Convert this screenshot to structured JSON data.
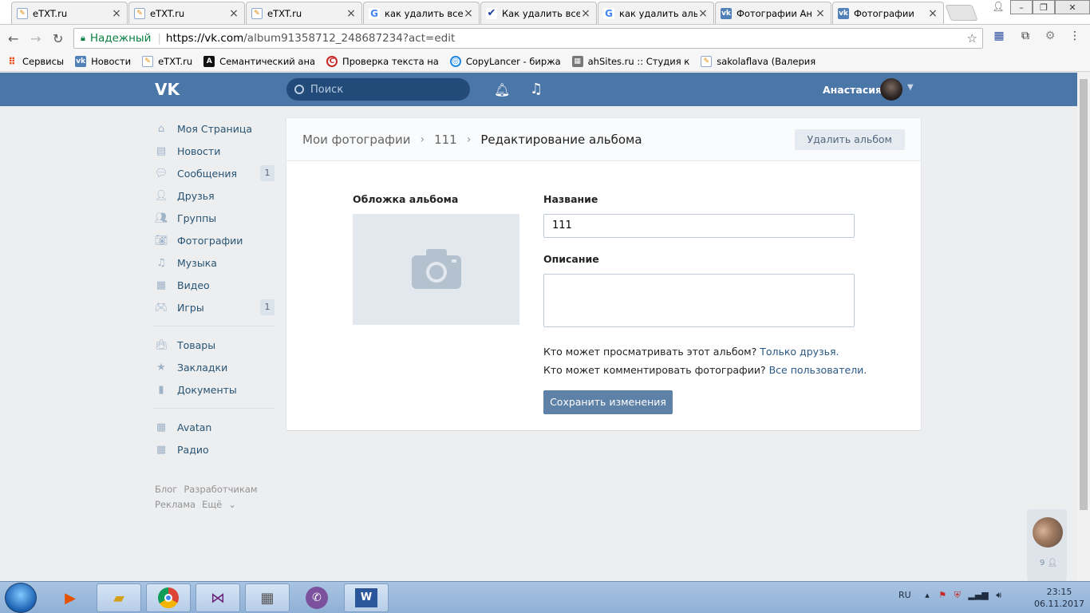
{
  "browser": {
    "tabs": [
      {
        "title": "eTXT.ru",
        "icon": "etxt-favicon"
      },
      {
        "title": "eTXT.ru",
        "icon": "etxt-favicon"
      },
      {
        "title": "eTXT.ru",
        "icon": "etxt-favicon"
      },
      {
        "title": "как удалить все",
        "icon": "google-favicon"
      },
      {
        "title": "Как удалить все",
        "icon": "checkmark-favicon"
      },
      {
        "title": "как удалить аль",
        "icon": "google-favicon"
      },
      {
        "title": "Фотографии Ан",
        "icon": "vk-favicon"
      },
      {
        "title": "Фотографии",
        "icon": "vk-favicon"
      }
    ],
    "secure_label": "Надежный",
    "url_host": "https://vk.com",
    "url_path": "/album91358712_248687234?act=edit",
    "bookmarks": [
      {
        "label": "Сервисы",
        "icon": "apps-icon"
      },
      {
        "label": "Новости",
        "icon": "vk-favicon"
      },
      {
        "label": "eTXT.ru",
        "icon": "etxt-favicon"
      },
      {
        "label": "Семантический ана",
        "icon": "a-favicon"
      },
      {
        "label": "Проверка текста на",
        "icon": "copyright-favicon"
      },
      {
        "label": "CopyLancer - биржа",
        "icon": "copylancer-favicon"
      },
      {
        "label": "ahSites.ru :: Студия к",
        "icon": "ahsites-favicon"
      },
      {
        "label": "sakolaflava (Валерия",
        "icon": "etxt-favicon"
      }
    ]
  },
  "vk": {
    "logo": "VK",
    "search_placeholder": "Поиск",
    "user_name": "Анастасия",
    "menu": [
      {
        "label": "Моя Страница",
        "icon": "home-icon",
        "count": ""
      },
      {
        "label": "Новости",
        "icon": "news-icon",
        "count": ""
      },
      {
        "label": "Сообщения",
        "icon": "messages-icon",
        "count": "1"
      },
      {
        "label": "Друзья",
        "icon": "friends-icon",
        "count": ""
      },
      {
        "label": "Группы",
        "icon": "groups-icon",
        "count": ""
      },
      {
        "label": "Фотографии",
        "icon": "camera-icon",
        "count": ""
      },
      {
        "label": "Музыка",
        "icon": "music-icon",
        "count": ""
      },
      {
        "label": "Видео",
        "icon": "video-icon",
        "count": ""
      },
      {
        "label": "Игры",
        "icon": "games-icon",
        "count": "1"
      }
    ],
    "menu2": [
      {
        "label": "Товары",
        "icon": "bag-icon"
      },
      {
        "label": "Закладки",
        "icon": "star-icon"
      },
      {
        "label": "Документы",
        "icon": "document-icon"
      }
    ],
    "menu3": [
      {
        "label": "Avatan",
        "icon": "apps-icon"
      },
      {
        "label": "Радио",
        "icon": "apps-icon"
      }
    ],
    "footer": {
      "blog": "Блог",
      "dev": "Разработчикам",
      "ads": "Реклама",
      "more": "Ещё"
    }
  },
  "page": {
    "breadcrumb": [
      "Мои фотографии",
      "111",
      "Редактирование альбома"
    ],
    "delete_button": "Удалить альбом",
    "cover_label": "Обложка альбома",
    "name_label": "Название",
    "name_value": "111",
    "description_label": "Описание",
    "description_value": "",
    "view_question": "Кто может просматривать этот альбом?",
    "view_value": "Только друзья.",
    "comment_question": "Кто может комментировать фотографии?",
    "comment_value": "Все пользователи.",
    "save_button": "Сохранить изменения"
  },
  "side_widget": {
    "count": "9"
  },
  "taskbar": {
    "lang": "RU",
    "time": "23:15",
    "date": "06.11.2017"
  },
  "colors": {
    "vk_blue": "#4a76a8",
    "link": "#2a5885",
    "save_button": "#5e81a8"
  }
}
